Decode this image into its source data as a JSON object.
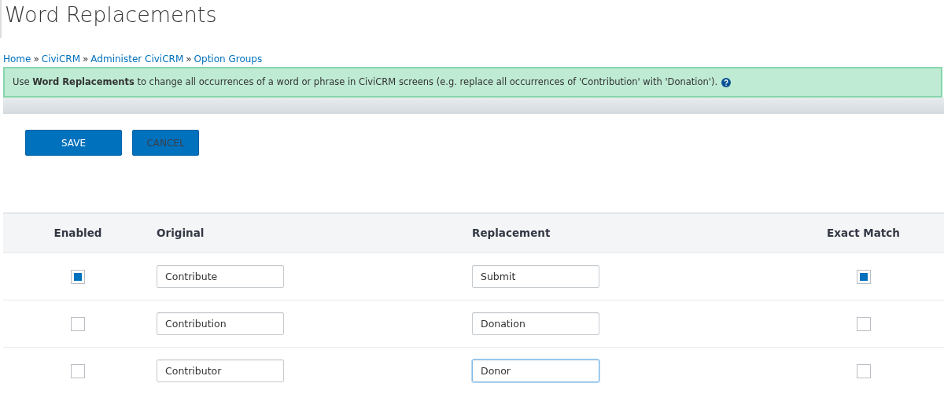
{
  "title": "Word Replacements",
  "breadcrumb": [
    "Home",
    "CiviCRM",
    "Administer CiviCRM",
    "Option Groups"
  ],
  "breadcrumb_separator": "»",
  "help_text": "Use **Word Replacements** to change all occurrences of a word or phrase in CiviCRM screens (e.g. replace all occurrences of 'Contribution' with 'Donation').",
  "buttons": [
    "SAVE",
    "CANCEL"
  ],
  "table": {
    "columns": [
      "Enabled",
      "Original",
      "Replacement",
      "Exact Match"
    ],
    "rows": [
      {
        "enabled": true,
        "original": "Contribute",
        "replacement": "Submit",
        "replacement_focused": false,
        "exact_match": true
      },
      {
        "enabled": false,
        "original": "Contribution",
        "replacement": "Donation",
        "replacement_focused": false,
        "exact_match": false
      },
      {
        "enabled": false,
        "original": "Contributor",
        "replacement": "Donor",
        "replacement_focused": true,
        "exact_match": false
      }
    ]
  }
}
